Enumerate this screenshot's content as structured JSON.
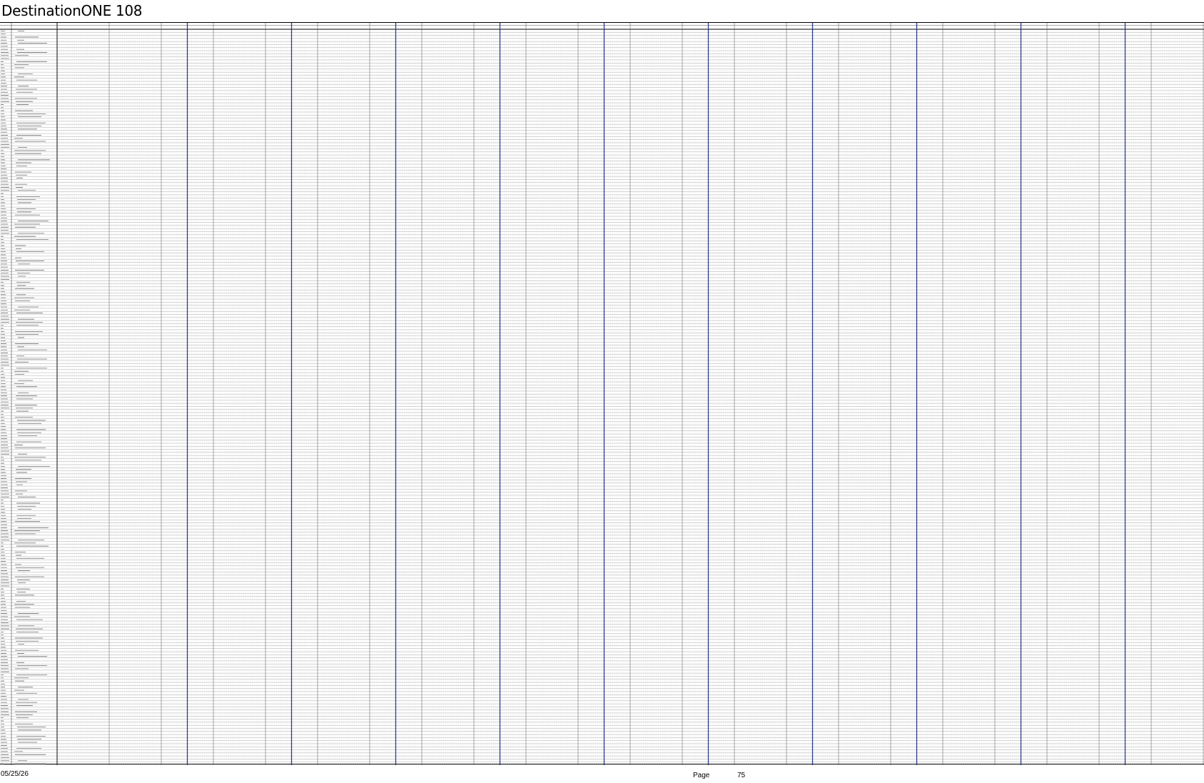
{
  "document": {
    "title": "DestinationONE 108"
  },
  "grid": {
    "header_labels": [
      "",
      "",
      "",
      ""
    ],
    "row_count": 240,
    "week_groups": 22,
    "cells_per_group": 24,
    "highlight_group_every": [
      3,
      2,
      2,
      2,
      2,
      2,
      2,
      2,
      2,
      2
    ],
    "line_color": "#8a8a8a",
    "cell_border_color": "#b0b0b0",
    "highlight_line_color": "#2b3a8c",
    "text_placeholder_color": "#6a6a6a"
  },
  "footer": {
    "date": "05/25/26",
    "page_label": "Page",
    "page_number": "75"
  }
}
